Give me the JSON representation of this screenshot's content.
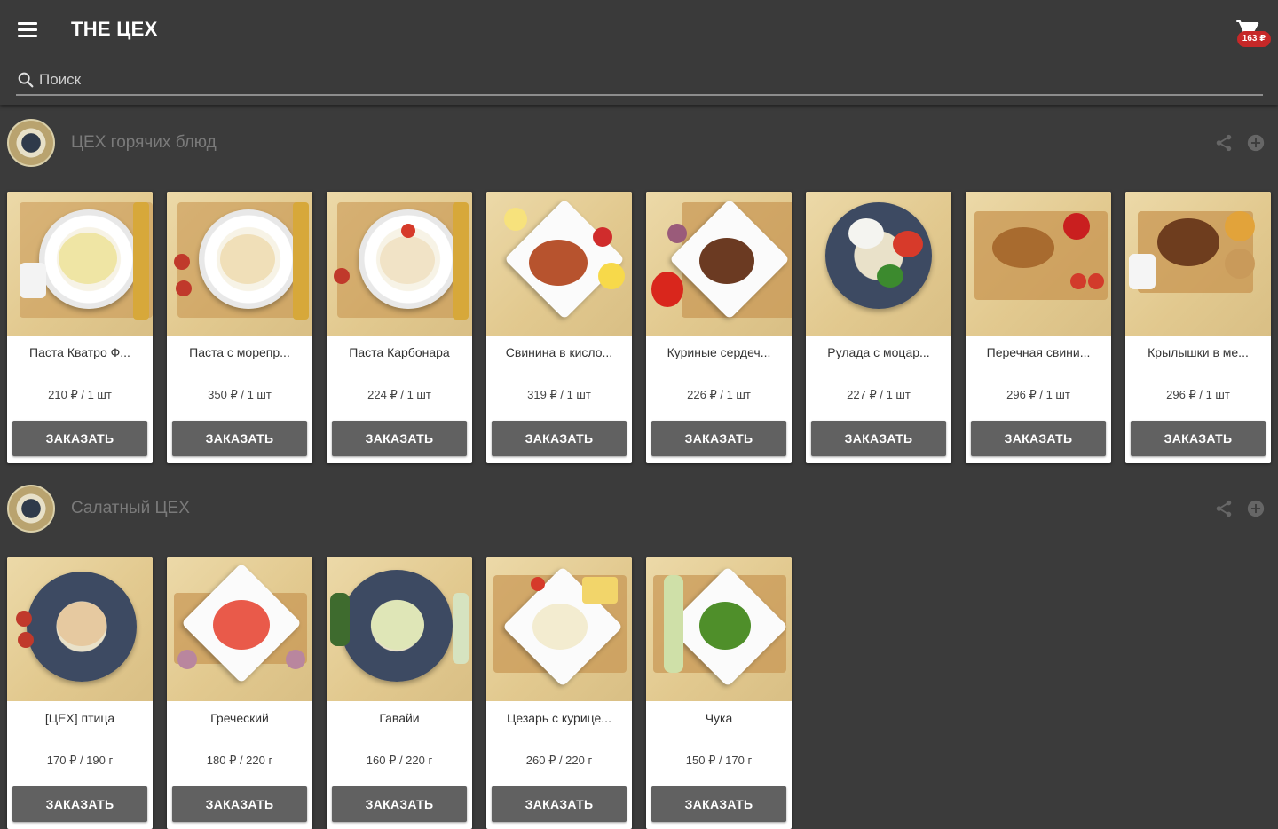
{
  "app": {
    "title": "THE ЦЕХ",
    "cart_badge": "163 ₽"
  },
  "search": {
    "placeholder": "Поиск"
  },
  "sections": [
    {
      "title": "ЦЕХ горячих блюд",
      "button_label": "ЗАКАЗАТЬ",
      "items": [
        {
          "name": "Паста Кватро Ф...",
          "price": "210 ₽ / 1 шт"
        },
        {
          "name": "Паста с морепр...",
          "price": "350 ₽ / 1 шт"
        },
        {
          "name": "Паста Карбонара",
          "price": "224 ₽ / 1 шт"
        },
        {
          "name": "Свинина в кисло...",
          "price": "319 ₽ / 1 шт"
        },
        {
          "name": "Куриные сердеч...",
          "price": "226 ₽ / 1 шт"
        },
        {
          "name": "Рулада с моцар...",
          "price": "227 ₽ / 1 шт"
        },
        {
          "name": "Перечная свини...",
          "price": "296 ₽ / 1 шт"
        },
        {
          "name": "Крылышки в ме...",
          "price": "296 ₽ / 1 шт"
        }
      ]
    },
    {
      "title": "Салатный ЦЕХ",
      "button_label": "ЗАКАЗАТЬ",
      "items": [
        {
          "name": "[ЦЕХ] птица",
          "price": "170 ₽ / 190 г"
        },
        {
          "name": "Греческий",
          "price": "180 ₽ / 220 г"
        },
        {
          "name": "Гавайи",
          "price": "160 ₽ / 220 г"
        },
        {
          "name": "Цезарь с курице...",
          "price": "260 ₽ / 220 г"
        },
        {
          "name": "Чука",
          "price": "150 ₽ / 170 г"
        }
      ]
    }
  ],
  "colors": {
    "background": "#3b3b3b",
    "button": "#616161",
    "badge": "#c62828"
  }
}
